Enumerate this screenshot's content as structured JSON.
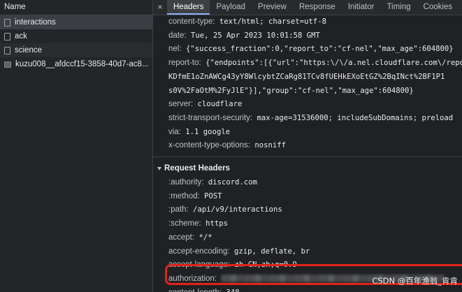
{
  "list": {
    "header": "Name",
    "items": [
      {
        "name": "interactions",
        "icon": "document-icon"
      },
      {
        "name": "ack",
        "icon": "document-icon"
      },
      {
        "name": "science",
        "icon": "document-icon"
      },
      {
        "name": "kuzu008__afdccf15-3858-40d7-ac8...",
        "icon": "image-icon"
      }
    ]
  },
  "tabs": {
    "close": "×",
    "items": [
      "Headers",
      "Payload",
      "Preview",
      "Response",
      "Initiator",
      "Timing",
      "Cookies"
    ],
    "active": "Headers"
  },
  "response_headers": [
    {
      "key": "content-type:",
      "value": "text/html; charset=utf-8"
    },
    {
      "key": "date:",
      "value": "Tue, 25 Apr 2023 10:01:58 GMT"
    },
    {
      "key": "nel:",
      "value": "{\"success_fraction\":0,\"report_to\":\"cf-nel\",\"max_age\":604800}"
    },
    {
      "key": "report-to:",
      "value": "{\"endpoints\":[{\"url\":\"https:\\/\\/a.nel.cloudflare.com\\/report"
    },
    {
      "key": "",
      "value": "KDfmE1oZnAWCg43yY8WlcybtZCaRg81TCv8fUEHkEXoEtGZ%2BqINct%2BF1P1"
    },
    {
      "key": "",
      "value": "s0V%2FaOtM%2FyJlE\"}],\"group\":\"cf-nel\",\"max_age\":604800}"
    },
    {
      "key": "server:",
      "value": "cloudflare"
    },
    {
      "key": "strict-transport-security:",
      "value": "max-age=31536000; includeSubDomains; preload"
    },
    {
      "key": "via:",
      "value": "1.1 google"
    },
    {
      "key": "x-content-type-options:",
      "value": "nosniff"
    }
  ],
  "request_section": {
    "title": "Request Headers",
    "headers": [
      {
        "key": ":authority:",
        "value": "discord.com"
      },
      {
        "key": ":method:",
        "value": "POST"
      },
      {
        "key": ":path:",
        "value": "/api/v9/interactions"
      },
      {
        "key": ":scheme:",
        "value": "https"
      },
      {
        "key": "accept:",
        "value": "*/*"
      },
      {
        "key": "accept-encoding:",
        "value": "gzip, deflate, br"
      },
      {
        "key": "accept-language:",
        "value": "zh-CN,zh;q=0.9"
      },
      {
        "key": "authorization:",
        "value": ""
      },
      {
        "key": "content-length:",
        "value": "348"
      }
    ]
  },
  "watermark": "CSDN @百年渔翁_肯肯",
  "colors": {
    "highlight": "#e0231b",
    "active_tab": "#8ab4f8",
    "background": "#202124"
  }
}
